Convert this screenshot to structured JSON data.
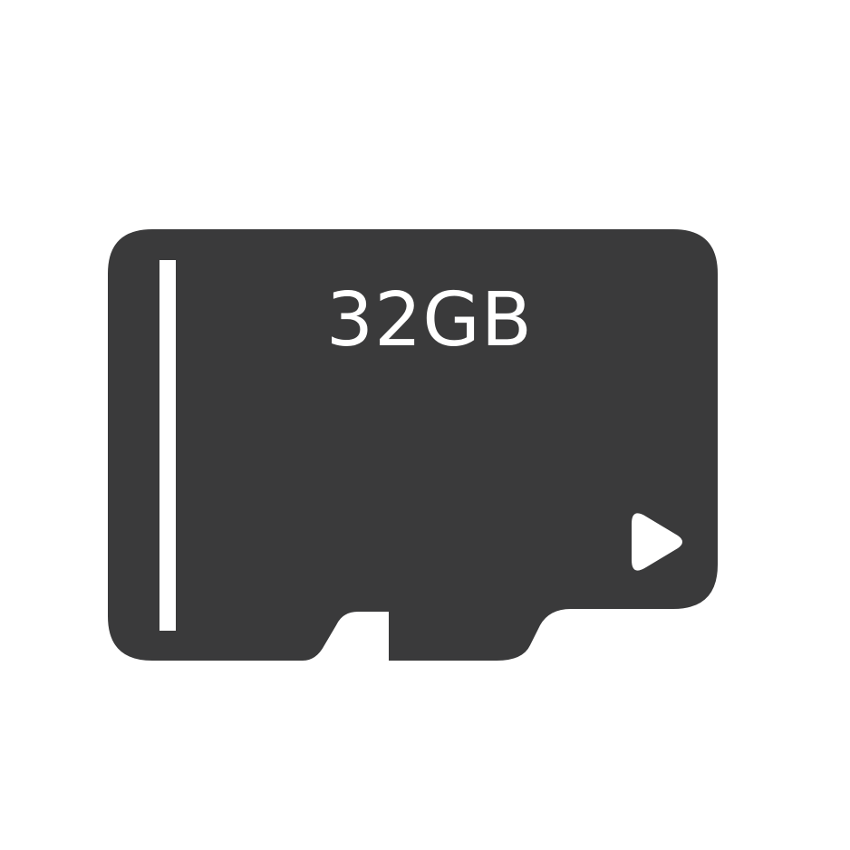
{
  "card": {
    "capacity_label": "32GB",
    "icon": "microsd-card-icon",
    "insert_arrow_icon": "play-arrow-icon"
  },
  "colors": {
    "card_body": "#3a3a3b",
    "foreground": "#ffffff",
    "background": "#ffffff"
  }
}
